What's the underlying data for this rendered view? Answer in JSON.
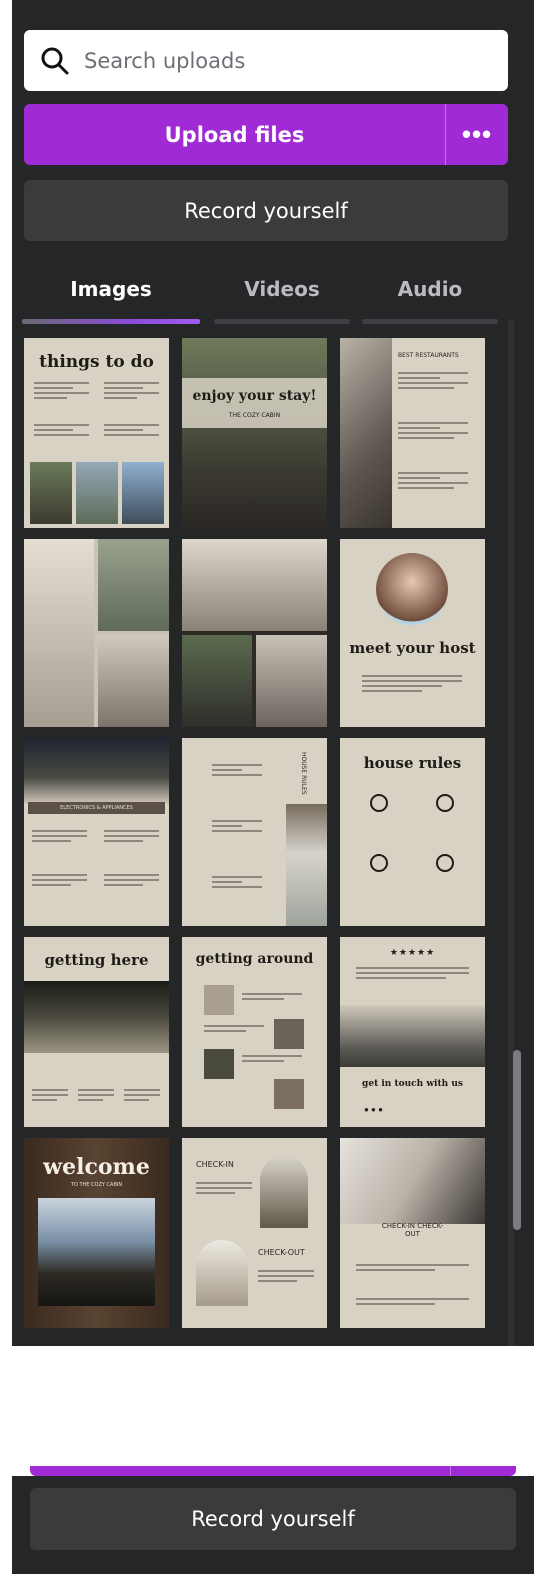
{
  "search": {
    "placeholder": "Search uploads"
  },
  "upload": {
    "label": "Upload files",
    "more_label": "•••"
  },
  "record": {
    "label": "Record yourself"
  },
  "tabs": [
    {
      "label": "Images",
      "active": true
    },
    {
      "label": "Videos",
      "active": false
    },
    {
      "label": "Audio",
      "active": false
    }
  ],
  "thumbnails": [
    {
      "title": "things to do"
    },
    {
      "title": "enjoy your stay!",
      "subtitle": "THE COZY CABIN"
    },
    {
      "title": "BEST RESTAURANTS"
    },
    {
      "title": ""
    },
    {
      "title": ""
    },
    {
      "title": "meet your host"
    },
    {
      "title": "ELECTRONICS & APPLIANCES"
    },
    {
      "title": "HOUSE RULES"
    },
    {
      "title": "house rules"
    },
    {
      "title": "getting here"
    },
    {
      "title": "getting around"
    },
    {
      "title": "get in touch with us",
      "rating": "★★★★★"
    },
    {
      "title": "welcome",
      "subtitle": "TO THE COZY CABIN"
    },
    {
      "title": "CHECK-IN",
      "subtitle": "CHECK-OUT"
    },
    {
      "title": "CHECK-IN CHECK-OUT"
    }
  ],
  "record_bottom": {
    "label": "Record yourself"
  },
  "colors": {
    "panel": "#252627",
    "accent": "#a02ad6",
    "card": "#d8d2c4"
  }
}
